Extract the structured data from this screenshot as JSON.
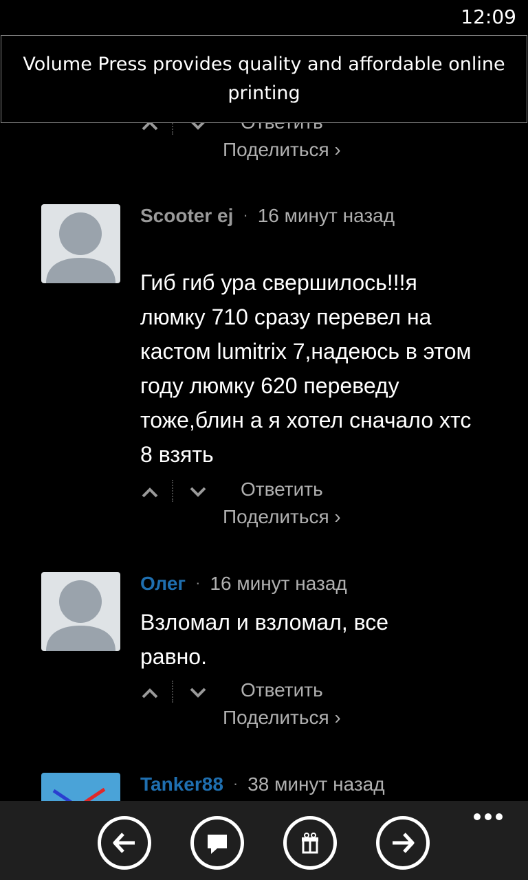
{
  "status": {
    "time": "12:09"
  },
  "ad": {
    "text": "Volume Press provides quality and affordable online printing"
  },
  "comments": [
    {
      "actions": {
        "reply": "Ответить",
        "share": "Поделиться ›"
      }
    },
    {
      "author": "Scooter ej",
      "time": "16 минут назад",
      "text": "Гиб гиб ура свершилось!!!я люмку 710 сразу перевел на кастом lumitrix 7,надеюсь в этом году люмку 620 переведу тоже,блин а я хотел сначало xтс 8 взять",
      "actions": {
        "reply": "Ответить",
        "share": "Поделиться ›"
      }
    },
    {
      "author": "Олег",
      "time": "16 минут назад",
      "text": "Взломал и взломал, все равно.",
      "actions": {
        "reply": "Ответить",
        "share": "Поделиться ›"
      }
    },
    {
      "author": "Tanker88",
      "time": "38 минут назад"
    }
  ],
  "separator": "·",
  "colors": {
    "author_link": "#1f6fb0",
    "author_plain": "#9a9a9a",
    "app_bar": "#1f1f1f"
  },
  "app_bar": {
    "buttons": [
      {
        "icon": "back-arrow-icon"
      },
      {
        "icon": "comment-icon"
      },
      {
        "icon": "gift-icon"
      },
      {
        "icon": "forward-arrow-icon"
      }
    ],
    "more_icon": "more-dots-icon"
  }
}
